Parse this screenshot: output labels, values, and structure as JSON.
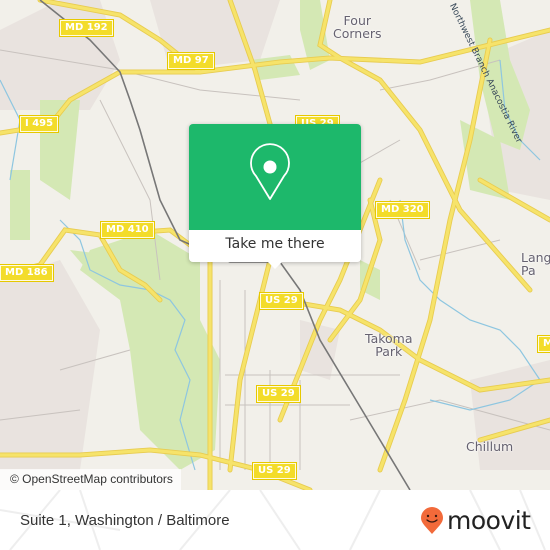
{
  "map": {
    "road_shields": [
      {
        "label": "MD 192"
      },
      {
        "label": "MD 97"
      },
      {
        "label": "I 495"
      },
      {
        "label": "US 29"
      },
      {
        "label": "MD 320"
      },
      {
        "label": "MD 410"
      },
      {
        "label": "MD 186"
      },
      {
        "label": "US 29"
      },
      {
        "label": "US 29"
      },
      {
        "label": "US 29"
      },
      {
        "label": "M"
      }
    ],
    "places": [
      {
        "label": "Four\nCorners"
      },
      {
        "label": "Takoma\nPark"
      },
      {
        "label": "Chillum"
      },
      {
        "label": "Lang\nPa"
      }
    ],
    "river_label": "Northwest Branch Anacostia River",
    "attribution": "© OpenStreetMap contributors",
    "colors": {
      "land": "#f2f0ea",
      "park": "#d4e8b4",
      "road": "#f6e36a",
      "water": "#8ec6e0",
      "popup_green": "#1db86b"
    }
  },
  "popup": {
    "icon": "location-pin-icon",
    "button_label": "Take me there"
  },
  "footer": {
    "title": "Suite 1, Washington / Baltimore",
    "brand": "moovit",
    "brand_color": "#f26a3a"
  }
}
